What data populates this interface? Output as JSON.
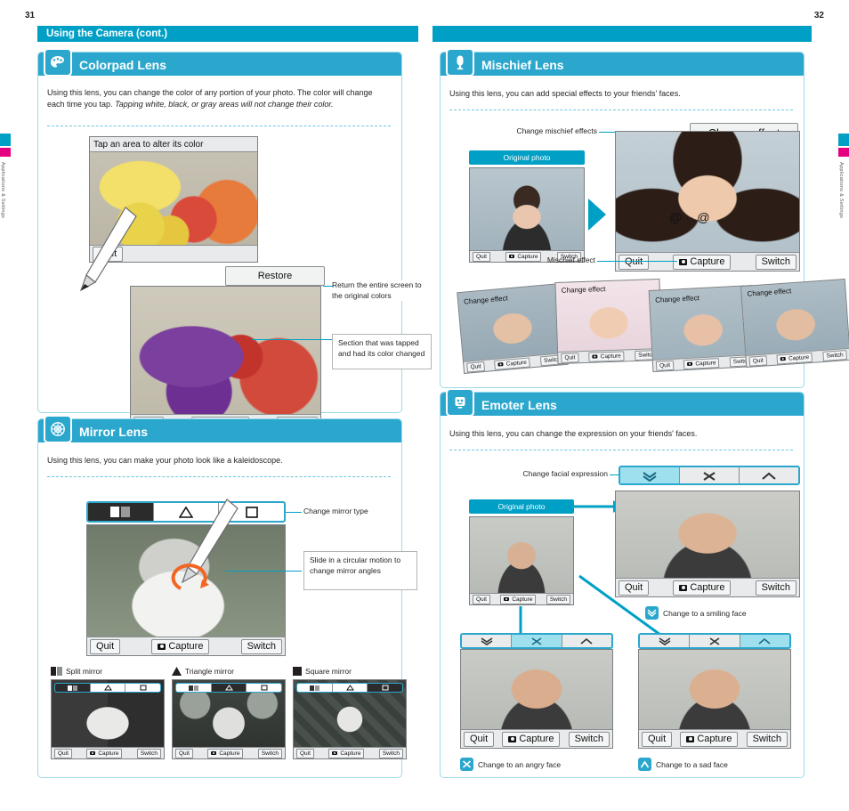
{
  "pages": {
    "left_number": "31",
    "right_number": "32"
  },
  "side_tabs": {
    "text": "Applications & Settings"
  },
  "headers": {
    "left": "Using the Camera (cont.)",
    "right": ""
  },
  "sections": {
    "colorpad": {
      "title": "Colorpad Lens",
      "intro": "Using this lens, you can change the color of any portion of your photo. The color will change each time you tap.",
      "intro_italic": "Tapping white, black, or gray areas will not change their color.",
      "screen_caption": "Tap an area to alter its color",
      "restore_label": "Restore",
      "quit_label": "Quit",
      "capture_label": "Capture",
      "switch_label": "Switch",
      "callout_restore": "Return the entire screen to the original colors",
      "callout_section": "Section that was tapped and had its color changed"
    },
    "mirror": {
      "title": "Mirror Lens",
      "intro": "Using this lens, you can make your photo look like a kaleidoscope.",
      "callout_type": "Change mirror type",
      "callout_slide": "Slide in a circular motion to change mirror angles",
      "quit_label": "Quit",
      "capture_label": "Capture",
      "switch_label": "Switch",
      "thumbs": [
        {
          "label": "Split mirror"
        },
        {
          "label": "Triangle mirror"
        },
        {
          "label": "Square mirror"
        }
      ],
      "thumb_buttons": {
        "quit": "Quit",
        "capture": "Capture",
        "switch": "Switch"
      }
    },
    "mischief": {
      "title": "Mischief Lens",
      "intro": "Using this lens, you can add special effects to your friends' faces.",
      "callout_change": "Change mischief effects",
      "callout_effect": "Mischief effect",
      "original_photo": "Original photo",
      "change_effect_label": "Change effect",
      "quit_label": "Quit",
      "capture_label": "Capture",
      "switch_label": "Switch",
      "thumbs": [
        {
          "effect_label": "Change effect"
        },
        {
          "effect_label": "Change effect"
        },
        {
          "effect_label": "Change effect"
        },
        {
          "effect_label": "Change effect"
        }
      ],
      "thumb_buttons": {
        "quit": "Quit",
        "capture": "Capture",
        "switch": "Switch"
      }
    },
    "emoter": {
      "title": "Emoter Lens",
      "intro": "Using this lens, you can change the expression on your friends' faces.",
      "callout_expression": "Change facial expression",
      "original_photo": "Original photo",
      "quit_label": "Quit",
      "capture_label": "Capture",
      "switch_label": "Switch",
      "caption_smile": "Change to a smiling face",
      "caption_angry": "Change to an angry face",
      "caption_sad": "Change to a sad face"
    }
  },
  "colors": {
    "accent": "#00a0c6",
    "header": "#2ba7cd",
    "border": "#9fd9e9",
    "magenta": "#e4007f"
  }
}
